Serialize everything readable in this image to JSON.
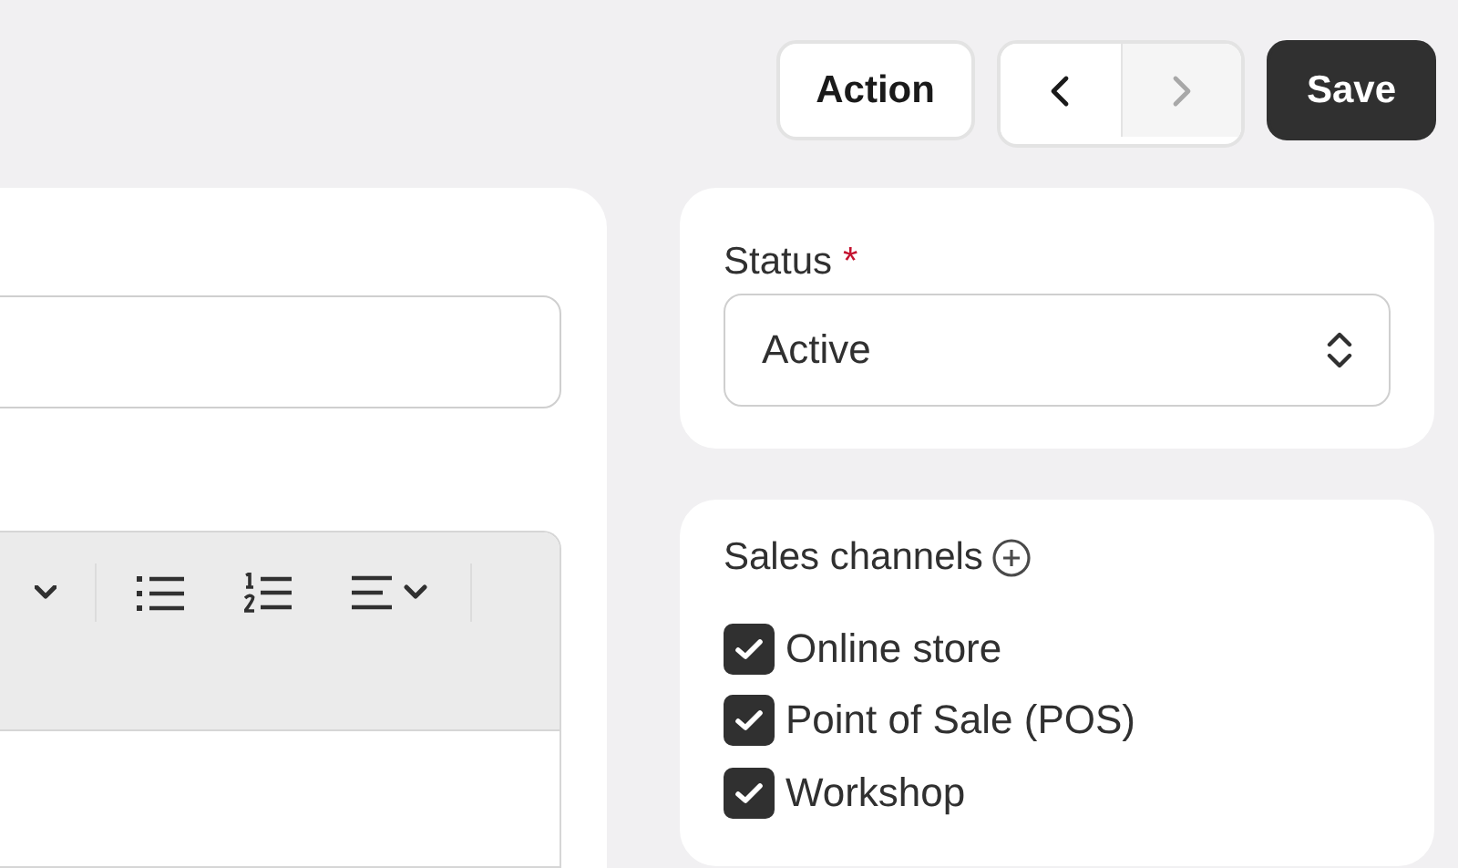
{
  "header_actions": {
    "action_button": "Action",
    "previous": {
      "disabled": false
    },
    "next": {
      "disabled": true
    },
    "save_button": "Save"
  },
  "editor": {
    "toolbar": [
      {
        "kind": "dropdown"
      },
      {
        "kind": "divider"
      },
      {
        "kind": "bullet_list"
      },
      {
        "kind": "numbered_list"
      },
      {
        "kind": "align"
      },
      {
        "kind": "divider"
      }
    ]
  },
  "status": {
    "label": "Status",
    "required_mark": "*",
    "value": "Active"
  },
  "sales_channels": {
    "title": "Sales channels",
    "items": [
      {
        "label": "Online store",
        "checked": true
      },
      {
        "label": "Point of Sale (POS)",
        "checked": true
      },
      {
        "label": "Workshop",
        "checked": true
      }
    ]
  }
}
